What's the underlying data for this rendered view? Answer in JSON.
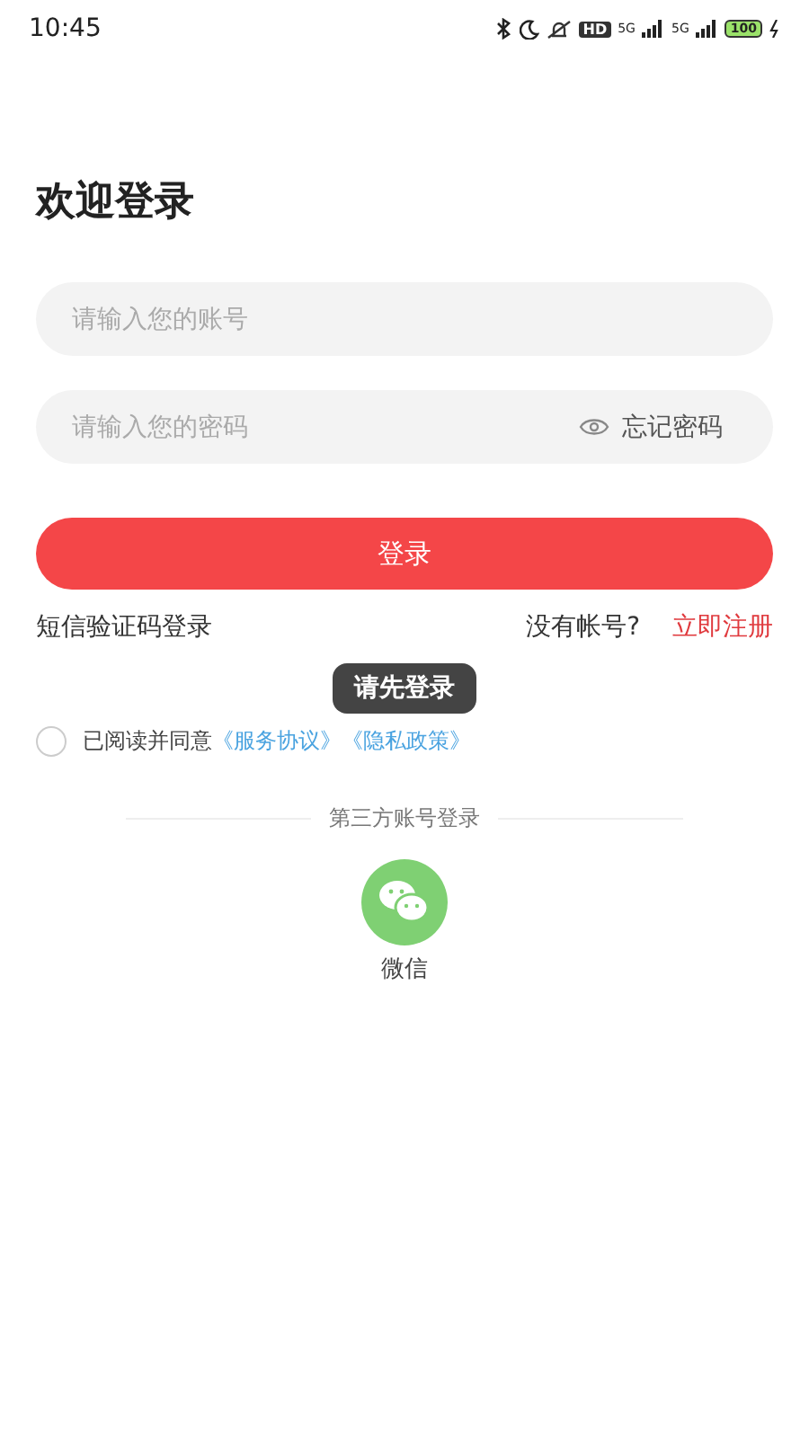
{
  "status_bar": {
    "time": "10:45",
    "hd": "HD",
    "network_1": "5G",
    "network_2": "5G",
    "battery": "100"
  },
  "title": "欢迎登录",
  "account_field": {
    "placeholder": "请输入您的账号"
  },
  "password_field": {
    "placeholder": "请输入您的密码",
    "forgot": "忘记密码"
  },
  "login_button": "登录",
  "sms_login": "短信验证码登录",
  "no_account": "没有帐号?",
  "register": "立即注册",
  "toast": "请先登录",
  "agreement": {
    "checked": false,
    "text": "已阅读并同意",
    "links": [
      "《服务协议》",
      "《隐私政策》"
    ]
  },
  "third_party": {
    "heading": "第三方账号登录",
    "items": [
      {
        "kind": "wechat",
        "label": "微信"
      }
    ]
  }
}
